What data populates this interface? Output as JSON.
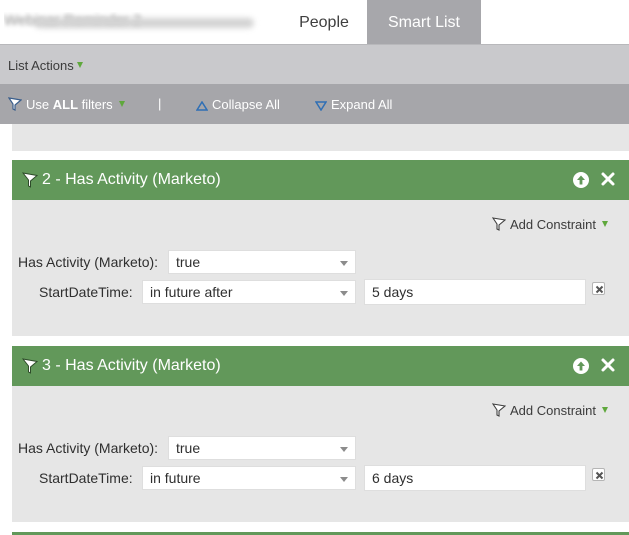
{
  "tabs": {
    "current_title": "Webinar Reminder 2",
    "people_label": "People",
    "smart_list_label": "Smart List"
  },
  "list_actions": {
    "label": "List Actions"
  },
  "toolbar": {
    "use_prefix": "Use ",
    "use_bold": "ALL",
    "use_suffix": " filters",
    "separator": "|",
    "collapse_label": "Collapse All",
    "expand_label": "Expand All"
  },
  "filters": [
    {
      "title": "2 - Has Activity (Marketo)",
      "add_constraint_label": "Add Constraint",
      "row1": {
        "label": "Has Activity (Marketo):",
        "value": "true"
      },
      "row2": {
        "label": "StartDateTime:",
        "operator": "in future after",
        "value": "5 days"
      }
    },
    {
      "title": "3 - Has Activity (Marketo)",
      "add_constraint_label": "Add Constraint",
      "row1": {
        "label": "Has Activity (Marketo):",
        "value": "true"
      },
      "row2": {
        "label": "StartDateTime:",
        "operator": "in future",
        "value": "6 days"
      }
    }
  ],
  "colors": {
    "header_green": "#62985a",
    "toolbar_gray": "#a6a6aa",
    "actions_gray": "#c9c9cc",
    "panel_gray": "#e6e6e6",
    "dropdown_triangle_green": "#5fa83c"
  },
  "icons": {
    "filter": "funnel-icon",
    "move_up": "arrow-up-circle-icon",
    "delete": "close-x-icon",
    "remove_row": "small-x-box-icon",
    "collapse": "triangle-up-outline-icon",
    "expand": "triangle-down-outline-icon"
  }
}
